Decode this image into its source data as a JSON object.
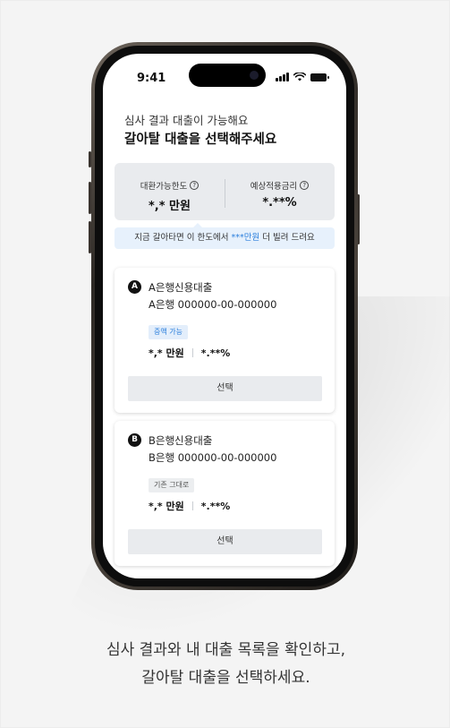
{
  "status_bar": {
    "time": "9:41"
  },
  "header": {
    "subtitle": "심사 결과 대출이 가능해요",
    "title": "갈아탈 대출을 선택해주세요"
  },
  "limit_box": {
    "left_label": "대환가능한도",
    "left_value": "*,* 만원",
    "right_label": "예상적용금리",
    "right_value": "*.**%",
    "info_glyph": "?"
  },
  "notice": {
    "prefix": "지금 갈아타면 이 한도에서 ",
    "highlight": "***만원",
    "suffix": " 더 빌려 드려요"
  },
  "loans": [
    {
      "letter": "A",
      "name": "A은행신용대출",
      "account": "A은행 000000-00-000000",
      "tag": "증액 가능",
      "tag_color": "#2b7fdc",
      "amount": "*,* 만원",
      "rate": "*.**%",
      "button": "선택"
    },
    {
      "letter": "B",
      "name": "B은행신용대출",
      "account": "B은행 000000-00-000000",
      "tag": "기존 그대로",
      "tag_color": "#555555",
      "amount": "*,* 만원",
      "rate": "*.**%",
      "button": "선택"
    }
  ],
  "caption": {
    "line1": "심사 결과와 내 대출 목록을 확인하고,",
    "line2": "갈아탈 대출을 선택하세요."
  },
  "colors": {
    "accent": "#2b7fdc",
    "notice_bg": "#e7f1fc",
    "box_bg": "#e9ebee"
  }
}
